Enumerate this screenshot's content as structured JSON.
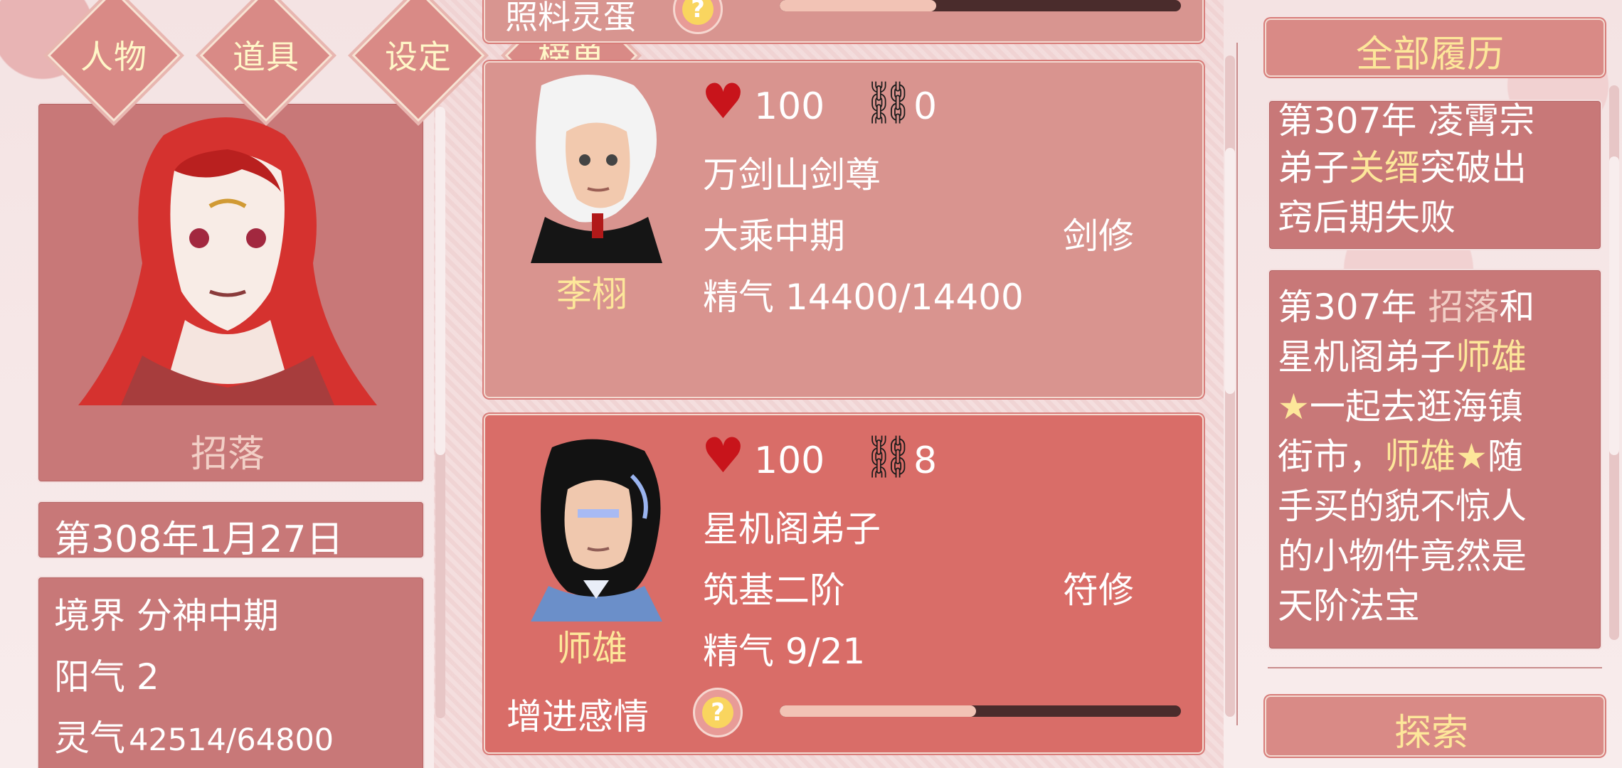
{
  "nav": {
    "items": [
      "人物",
      "道具",
      "设定",
      "榜单"
    ]
  },
  "profile": {
    "name": "招落",
    "date": "第308年1月27日",
    "realm_label": "境界",
    "realm_value": "分神中期",
    "yang_label": "阳气",
    "yang_value": "2",
    "spirit_label": "灵气",
    "spirit_value": "42514/64800"
  },
  "top_partial": {
    "label": "照料灵蛋",
    "progress": 0.39
  },
  "characters": [
    {
      "name": "李栩",
      "affection": "100",
      "bond": "0",
      "title": "万剑山剑尊",
      "stage": "大乘中期",
      "class": "剑修",
      "essence_label": "精气",
      "essence_value": "14400/14400"
    },
    {
      "name": "师雄",
      "affection": "100",
      "bond": "8",
      "title": "星机阁弟子",
      "stage": "筑基二阶",
      "class": "符修",
      "essence_label": "精气",
      "essence_value": "9/21",
      "action_label": "增进感情",
      "progress": 0.49
    }
  ],
  "history": {
    "button_label": "全部履历",
    "entry1": {
      "line1": "第307年 凌霄宗",
      "line2_prefix": "弟子",
      "line2_name": "关缙",
      "line2_suffix": "突破出",
      "line3": "窍后期失败"
    },
    "entry2": {
      "line1_prefix": "第307年 ",
      "line1_name": "招落",
      "line1_suffix": "和",
      "line2_prefix": "星机阁弟子",
      "line2_name": "师雄",
      "line3_star": "★",
      "line3_text": "一起去逛海镇",
      "line4_prefix": "街市，",
      "line4_name": "师雄",
      "line4_star": "★",
      "line4_suffix": "随",
      "line5": "手买的貌不惊人",
      "line6": "的小物件竟然是",
      "line7": "天阶法宝"
    },
    "explore_label": "探索"
  },
  "colors": {
    "panel": "#c87878",
    "card": "#d99a95",
    "card_active": "#d96a66",
    "gold": "#fde79a",
    "heart": "#c8141b"
  }
}
